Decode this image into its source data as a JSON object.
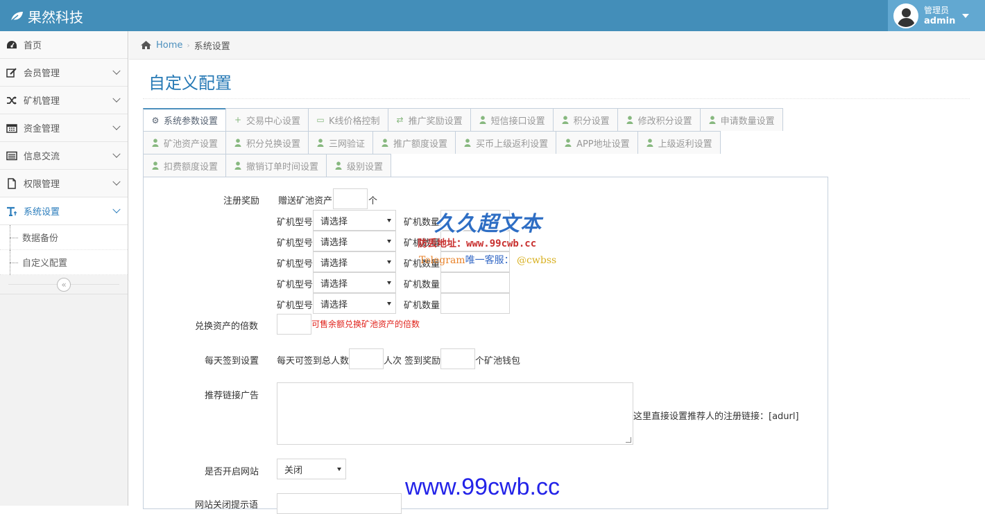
{
  "app": {
    "brand": "果然科技"
  },
  "user": {
    "role": "管理员",
    "name": "admin"
  },
  "sidebar": {
    "items": [
      {
        "label": "首页"
      },
      {
        "label": "会员管理"
      },
      {
        "label": "矿机管理"
      },
      {
        "label": "资金管理"
      },
      {
        "label": "信息交流"
      },
      {
        "label": "权限管理"
      },
      {
        "label": "系统设置"
      }
    ],
    "sub_items": [
      {
        "label": "数据备份"
      },
      {
        "label": "自定义配置"
      }
    ],
    "collapse_icon": "«"
  },
  "breadcrumb": {
    "home": "Home",
    "current": "系统设置"
  },
  "page": {
    "title": "自定义配置"
  },
  "tabs": {
    "row1": [
      "系统参数设置",
      "交易中心设置",
      "K线价格控制",
      "推广奖励设置",
      "短信接口设置",
      "积分设置",
      "修改积分设置",
      "申请数量设置"
    ],
    "row2": [
      "矿池资产设置",
      "积分兑换设置",
      "三网验证",
      "推广额度设置",
      "买币上级返利设置",
      "APP地址设置",
      "上级返利设置"
    ],
    "row3": [
      "扣费额度设置",
      "撤销订单时间设置",
      "级别设置"
    ]
  },
  "form": {
    "register_label": "注册奖励",
    "gift_prefix": "赠送矿池资产",
    "gift_suffix": "个",
    "miner_type_label": "矿机型号",
    "miner_count_label": "矿机数量",
    "select_placeholder": "请选择",
    "exchange_label": "兑换资产的倍数",
    "exchange_hint": "可售余额兑换矿池资产的倍数",
    "checkin_label": "每天签到设置",
    "checkin_prefix": "每天可签到总人数",
    "checkin_mid": "人次 签到奖励",
    "checkin_suffix": "个矿池钱包",
    "ad_label": "推荐链接广告",
    "ad_hint": "这里直接设置推荐人的注册链接：[adurl]",
    "site_open_label": "是否开启网站",
    "site_open_value": "关闭",
    "site_close_msg_label": "网站关闭提示语"
  },
  "watermark": {
    "logo": "久久超文本",
    "url_label": "防丢地址：www.99cwb.cc",
    "tg_prefix": "Telegram",
    "tg_mid": "唯一客服：",
    "tg_handle": "@cwbss",
    "url_big": "www.99cwb.cc"
  },
  "colors": {
    "navbar": "#438eb9",
    "accent": "#2679b5",
    "tab_icon": "#87b87f",
    "hint": "#e0221b"
  }
}
